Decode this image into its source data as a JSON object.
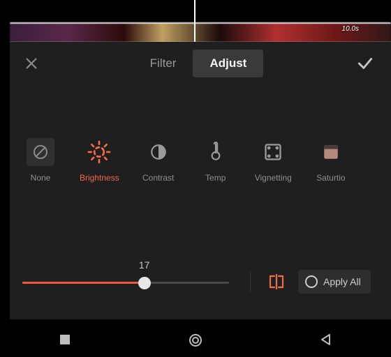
{
  "timeline": {
    "duration_label": "10.0s"
  },
  "tabs": {
    "filter": "Filter",
    "adjust": "Adjust",
    "active": "adjust"
  },
  "adjustments": [
    {
      "key": "none",
      "label": "None"
    },
    {
      "key": "brightness",
      "label": "Brightness",
      "selected": true
    },
    {
      "key": "contrast",
      "label": "Contrast"
    },
    {
      "key": "temp",
      "label": "Temp"
    },
    {
      "key": "vignetting",
      "label": "Vignetting"
    },
    {
      "key": "saturation",
      "label": "Saturtio"
    }
  ],
  "slider": {
    "value": 17,
    "min": -50,
    "max": 50,
    "fill_percent": 59
  },
  "apply_all": {
    "label": "Apply All"
  },
  "colors": {
    "accent": "#ef6b4a"
  }
}
